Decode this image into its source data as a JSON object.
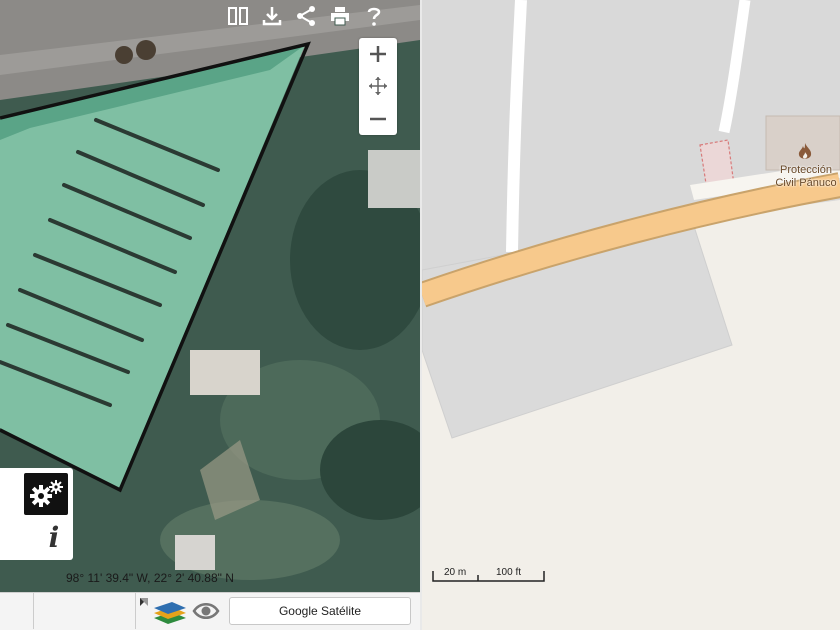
{
  "toolbar": {
    "buttons": [
      {
        "name": "compare-icon"
      },
      {
        "name": "download-icon"
      },
      {
        "name": "share-icon"
      },
      {
        "name": "print-icon"
      },
      {
        "name": "help-icon"
      }
    ]
  },
  "zoom": {
    "in_label": "+",
    "pan_icon": "pan-arrows-icon",
    "out_label": "−"
  },
  "settings": {
    "gear_icon": "gears-icon",
    "info_label": "i"
  },
  "coordinates": "98° 11' 39.4\" W, 22° 2' 40.88\" N",
  "basemap": {
    "label": "Google Satélite",
    "layers_icon": "layers-icon",
    "visibility_icon": "eye-icon"
  },
  "osm": {
    "poi": {
      "icon": "fire-station-icon",
      "label_line1": "Protección",
      "label_line2": "Civil Pánuco"
    },
    "scale": {
      "metric": "20 m",
      "imperial": "100 ft"
    }
  },
  "colors": {
    "road_primary": "#f7c98c",
    "landuse": "#d9d9d9",
    "background": "#f2efe9",
    "building": "#d9d0c9",
    "polygon_stroke": "#111111"
  }
}
